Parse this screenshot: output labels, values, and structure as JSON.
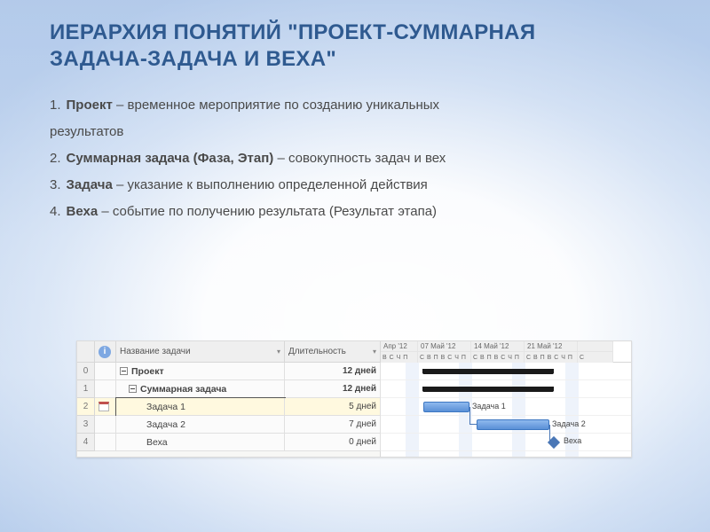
{
  "title_l1": "ИЕРАРХИЯ ПОНЯТИЙ \"ПРОЕКТ-СУММАРНАЯ",
  "title_l2": "ЗАДАЧА-ЗАДАЧА И ВЕХА\"",
  "items": [
    {
      "n": "1.",
      "b": "Проект",
      "t": " – временное мероприятие по созданию уникальных"
    },
    {
      "n": "",
      "b": "",
      "t": "результатов"
    },
    {
      "n": "2.",
      "b": "Суммарная задача (Фаза, Этап)",
      "t": " – совокупность задач и вех"
    },
    {
      "n": "3.",
      "b": "Задача",
      "t": " – указание к выполнению определенной действия"
    },
    {
      "n": "4.",
      "b": "Веха",
      "t": " – событие по получению результата (Результат этапа)"
    }
  ],
  "cols": {
    "name": "Название задачи",
    "dur": "Длительность"
  },
  "rows": [
    {
      "idx": "0",
      "name": "Проект",
      "dur": "12 дней",
      "indent": 0,
      "bold": true,
      "collapse": true
    },
    {
      "idx": "1",
      "name": "Суммарная задача",
      "dur": "12 дней",
      "indent": 1,
      "bold": true,
      "collapse": true
    },
    {
      "idx": "2",
      "name": "Задача 1",
      "dur": "5 дней",
      "indent": 2,
      "sel": true,
      "cal": true
    },
    {
      "idx": "3",
      "name": "Задача 2",
      "dur": "7 дней",
      "indent": 2
    },
    {
      "idx": "4",
      "name": "Веха",
      "dur": "0 дней",
      "indent": 2
    }
  ],
  "months": [
    "Апр '12",
    "07 Май '12",
    "14 Май '12",
    "21 Май '12",
    ""
  ],
  "days": "В С Ч П С В П В С Ч П С В П В С Ч П С В П В С Ч П С",
  "bars": {
    "t1": "Задача 1",
    "t2": "Задача 2",
    "mile": "Веха"
  }
}
